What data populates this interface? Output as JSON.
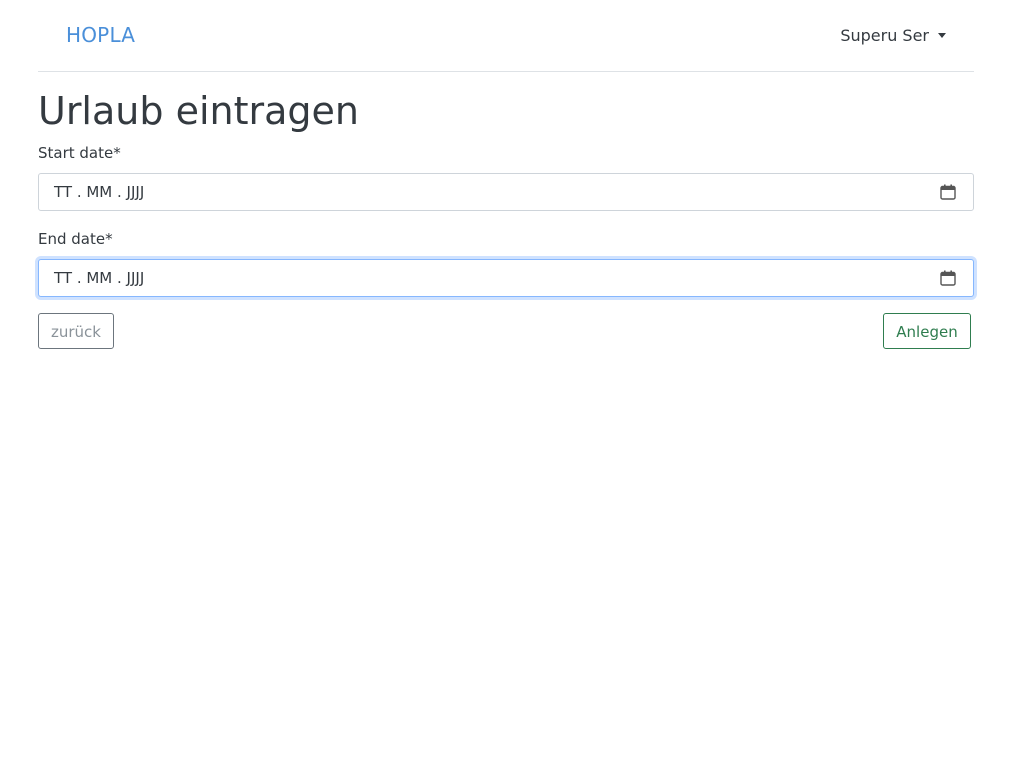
{
  "navbar": {
    "brand": "HOPLA",
    "user_name": "Superu Ser"
  },
  "page_title": "Urlaub eintragen",
  "form": {
    "start_date": {
      "label": "Start date*",
      "value": "TT . MM . JJJJ"
    },
    "end_date": {
      "label": "End date*",
      "value": "TT . MM . JJJJ"
    }
  },
  "buttons": {
    "back_label": "zurück",
    "create_label": "Anlegen"
  },
  "colors": {
    "brand": "#4a8fd9",
    "create_button": "#2f7d4f",
    "focus_border": "#86b7fe"
  },
  "icons": {
    "user_menu": "caret-down-icon",
    "date_picker": "calendar-icon"
  }
}
